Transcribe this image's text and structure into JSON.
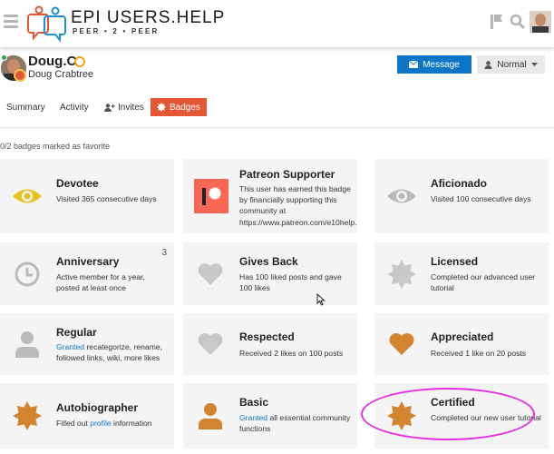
{
  "header": {
    "logo_title_accent": "EPI",
    "logo_title_rest": "USERS.HELP",
    "logo_subtitle": "PEER • 2 • PEER",
    "icons": [
      "hamburger-icon",
      "flag-icon",
      "search-icon",
      "user-avatar"
    ]
  },
  "user": {
    "username": "Doug.C",
    "full_name": "Doug Crabtree",
    "message_label": "Message",
    "notification_level": "Normal"
  },
  "tabs": [
    {
      "label": "Summary",
      "active": false
    },
    {
      "label": "Activity",
      "active": false
    },
    {
      "label": "Invites",
      "active": false
    },
    {
      "label": "Badges",
      "active": true
    }
  ],
  "favorites_text": "0/2 badges marked as favorite",
  "badges": [
    {
      "name": "Devotee",
      "desc": "Visited 365 consecutive days",
      "icon": "eye-icon",
      "color": "#e9c11f"
    },
    {
      "name": "Patreon Supporter",
      "desc": "This user has earned this badge by financially supporting this community at https://www.patreon.com/e10help.",
      "icon": "patreon-icon",
      "color": "#f96854"
    },
    {
      "name": "Aficionado",
      "desc": "Visited 100 consecutive days",
      "icon": "eye-icon",
      "color": "#bbbbbb"
    },
    {
      "name": "Anniversary",
      "desc": "Active member for a year, posted at least once",
      "icon": "clock-icon",
      "color": "#bbbbbb",
      "count": "3"
    },
    {
      "name": "Gives Back",
      "desc": "Has 100 liked posts and gave 100 likes",
      "icon": "heart-icon",
      "color": "#c8c8c8"
    },
    {
      "name": "Licensed",
      "desc": "Completed our advanced user tutorial",
      "icon": "certificate-icon",
      "color": "#c8c8c8"
    },
    {
      "name": "Regular",
      "desc_link": "Granted",
      "desc_rest": " recategorize, rename, followed links, wiki, more likes",
      "icon": "user-icon",
      "color": "#bbbbbb"
    },
    {
      "name": "Respected",
      "desc": "Received 2 likes on 100 posts",
      "icon": "heart-icon",
      "color": "#c8c8c8"
    },
    {
      "name": "Appreciated",
      "desc": "Received 1 like on 20 posts",
      "icon": "heart-icon",
      "color": "#d3842e"
    },
    {
      "name": "Autobiographer",
      "desc_pre": "Filled out ",
      "desc_link": "profile",
      "desc_rest": " information",
      "icon": "certificate-icon",
      "color": "#d3842e"
    },
    {
      "name": "Basic",
      "desc_link": "Granted",
      "desc_rest": " all essential community functions",
      "icon": "user-icon",
      "color": "#d3842e"
    },
    {
      "name": "Certified",
      "desc": "Completed our new user tutorial",
      "icon": "certificate-icon",
      "color": "#d3842e"
    }
  ],
  "colors": {
    "accent": "#e45735",
    "primary": "#0e76c9",
    "bronze": "#d3842e",
    "gold": "#e9c11f",
    "highlight": "#e62ae6"
  }
}
